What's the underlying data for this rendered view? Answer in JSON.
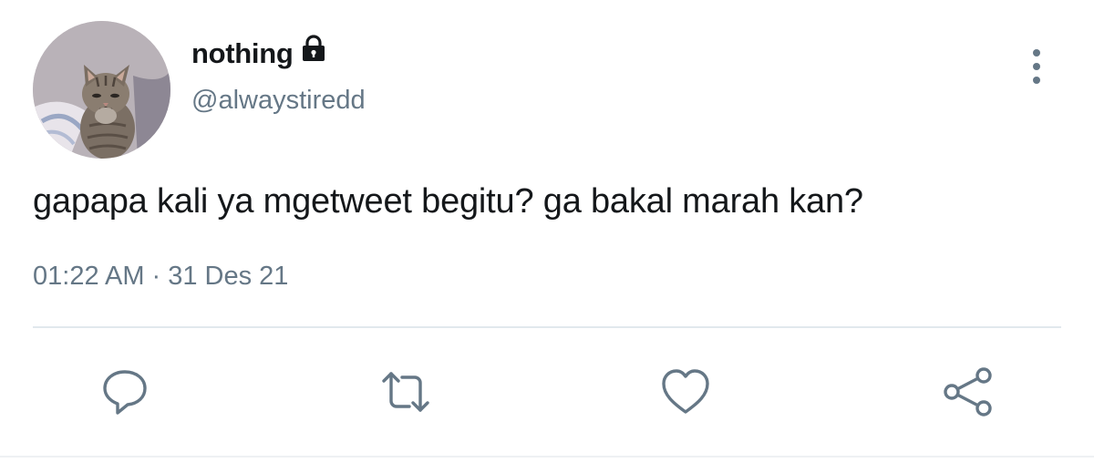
{
  "user": {
    "display_name": "nothing",
    "handle": "@alwaystiredd",
    "avatar": "avatar-photo-kitten",
    "protected_icon": "lock-icon"
  },
  "tweet": {
    "text": "gapapa kali ya mgetweet begitu? ga bakal marah kan?",
    "time": "01:22 AM",
    "separator": "·",
    "date": "31 Des 21"
  },
  "actions": [
    {
      "name": "reply",
      "icon": "reply-icon"
    },
    {
      "name": "retweet",
      "icon": "retweet-icon"
    },
    {
      "name": "like",
      "icon": "heart-icon"
    },
    {
      "name": "share",
      "icon": "share-icon"
    }
  ],
  "menu_icon": "more-vertical-icon",
  "colors": {
    "text_primary": "#14171a",
    "text_secondary": "#657786",
    "divider": "#e1e8ed"
  }
}
